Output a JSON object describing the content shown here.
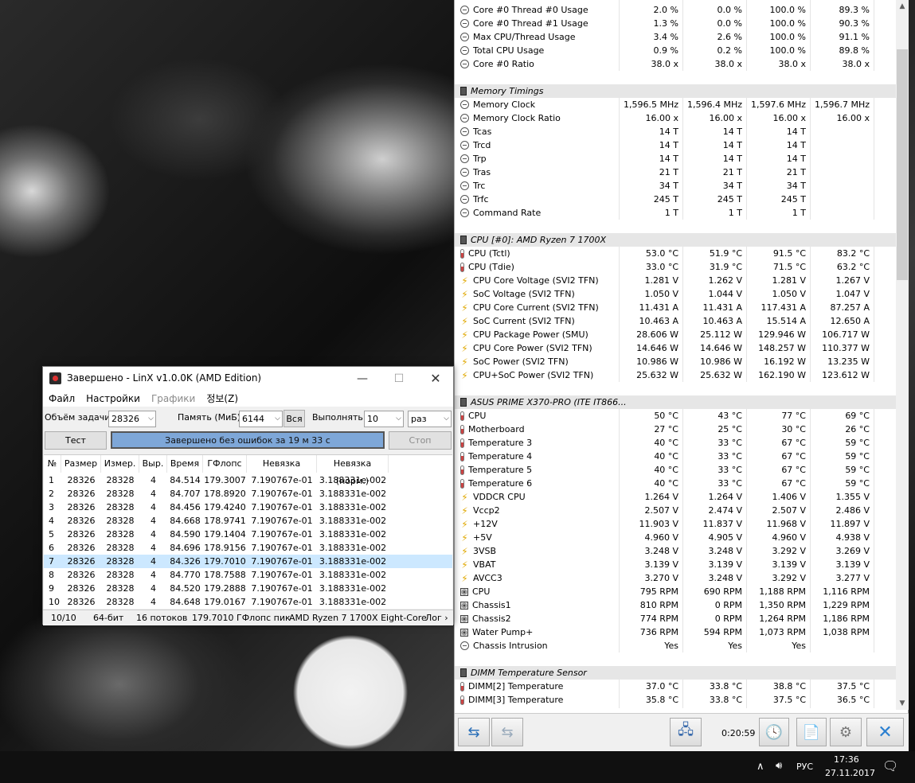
{
  "hwinfo": {
    "rows": [
      {
        "t": "r",
        "icon": "min",
        "name": "Core #0 Thread #0 Usage",
        "v": [
          "2.0 %",
          "0.0 %",
          "100.0 %",
          "89.3 %"
        ]
      },
      {
        "t": "r",
        "icon": "min",
        "name": "Core #0 Thread #1 Usage",
        "v": [
          "1.3 %",
          "0.0 %",
          "100.0 %",
          "90.3 %"
        ]
      },
      {
        "t": "r",
        "icon": "min",
        "name": "Max CPU/Thread Usage",
        "v": [
          "3.4 %",
          "2.6 %",
          "100.0 %",
          "91.1 %"
        ]
      },
      {
        "t": "r",
        "icon": "min",
        "name": "Total CPU Usage",
        "v": [
          "0.9 %",
          "0.2 %",
          "100.0 %",
          "89.8 %"
        ]
      },
      {
        "t": "r",
        "icon": "min",
        "name": "Core #0 Ratio",
        "v": [
          "38.0 x",
          "38.0 x",
          "38.0 x",
          "38.0 x"
        ]
      },
      {
        "t": "s"
      },
      {
        "t": "g",
        "name": "Memory Timings"
      },
      {
        "t": "r",
        "icon": "min",
        "name": "Memory Clock",
        "v": [
          "1,596.5 MHz",
          "1,596.4 MHz",
          "1,597.6 MHz",
          "1,596.7 MHz"
        ]
      },
      {
        "t": "r",
        "icon": "min",
        "name": "Memory Clock Ratio",
        "v": [
          "16.00 x",
          "16.00 x",
          "16.00 x",
          "16.00 x"
        ]
      },
      {
        "t": "r",
        "icon": "min",
        "name": "Tcas",
        "v": [
          "14 T",
          "14 T",
          "14 T",
          ""
        ]
      },
      {
        "t": "r",
        "icon": "min",
        "name": "Trcd",
        "v": [
          "14 T",
          "14 T",
          "14 T",
          ""
        ]
      },
      {
        "t": "r",
        "icon": "min",
        "name": "Trp",
        "v": [
          "14 T",
          "14 T",
          "14 T",
          ""
        ]
      },
      {
        "t": "r",
        "icon": "min",
        "name": "Tras",
        "v": [
          "21 T",
          "21 T",
          "21 T",
          ""
        ]
      },
      {
        "t": "r",
        "icon": "min",
        "name": "Trc",
        "v": [
          "34 T",
          "34 T",
          "34 T",
          ""
        ]
      },
      {
        "t": "r",
        "icon": "min",
        "name": "Trfc",
        "v": [
          "245 T",
          "245 T",
          "245 T",
          ""
        ]
      },
      {
        "t": "r",
        "icon": "min",
        "name": "Command Rate",
        "v": [
          "1 T",
          "1 T",
          "1 T",
          ""
        ]
      },
      {
        "t": "s"
      },
      {
        "t": "g",
        "name": "CPU [#0]: AMD Ryzen 7 1700X"
      },
      {
        "t": "r",
        "icon": "therm",
        "name": "CPU (Tctl)",
        "v": [
          "53.0 °C",
          "51.9 °C",
          "91.5 °C",
          "83.2 °C"
        ]
      },
      {
        "t": "r",
        "icon": "therm",
        "name": "CPU (Tdie)",
        "v": [
          "33.0 °C",
          "31.9 °C",
          "71.5 °C",
          "63.2 °C"
        ]
      },
      {
        "t": "r",
        "icon": "volt",
        "name": "CPU Core Voltage (SVI2 TFN)",
        "v": [
          "1.281 V",
          "1.262 V",
          "1.281 V",
          "1.267 V"
        ]
      },
      {
        "t": "r",
        "icon": "volt",
        "name": "SoC Voltage (SVI2 TFN)",
        "v": [
          "1.050 V",
          "1.044 V",
          "1.050 V",
          "1.047 V"
        ]
      },
      {
        "t": "r",
        "icon": "volt",
        "name": "CPU Core Current (SVI2 TFN)",
        "v": [
          "11.431 A",
          "11.431 A",
          "117.431 A",
          "87.257 A"
        ]
      },
      {
        "t": "r",
        "icon": "volt",
        "name": "SoC Current (SVI2 TFN)",
        "v": [
          "10.463 A",
          "10.463 A",
          "15.514 A",
          "12.650 A"
        ]
      },
      {
        "t": "r",
        "icon": "volt",
        "name": "CPU Package Power (SMU)",
        "v": [
          "28.606 W",
          "25.112 W",
          "129.946 W",
          "106.717 W"
        ]
      },
      {
        "t": "r",
        "icon": "volt",
        "name": "CPU Core Power (SVI2 TFN)",
        "v": [
          "14.646 W",
          "14.646 W",
          "148.257 W",
          "110.377 W"
        ]
      },
      {
        "t": "r",
        "icon": "volt",
        "name": "SoC Power (SVI2 TFN)",
        "v": [
          "10.986 W",
          "10.986 W",
          "16.192 W",
          "13.235 W"
        ]
      },
      {
        "t": "r",
        "icon": "volt",
        "name": "CPU+SoC Power (SVI2 TFN)",
        "v": [
          "25.632 W",
          "25.632 W",
          "162.190 W",
          "123.612 W"
        ]
      },
      {
        "t": "s"
      },
      {
        "t": "g",
        "name": "ASUS PRIME X370-PRO (ITE IT866..."
      },
      {
        "t": "r",
        "icon": "therm",
        "name": "CPU",
        "v": [
          "50 °C",
          "43 °C",
          "77 °C",
          "69 °C"
        ]
      },
      {
        "t": "r",
        "icon": "therm",
        "name": "Motherboard",
        "v": [
          "27 °C",
          "25 °C",
          "30 °C",
          "26 °C"
        ]
      },
      {
        "t": "r",
        "icon": "therm",
        "name": "Temperature 3",
        "v": [
          "40 °C",
          "33 °C",
          "67 °C",
          "59 °C"
        ]
      },
      {
        "t": "r",
        "icon": "therm",
        "name": "Temperature 4",
        "v": [
          "40 °C",
          "33 °C",
          "67 °C",
          "59 °C"
        ]
      },
      {
        "t": "r",
        "icon": "therm",
        "name": "Temperature 5",
        "v": [
          "40 °C",
          "33 °C",
          "67 °C",
          "59 °C"
        ]
      },
      {
        "t": "r",
        "icon": "therm",
        "name": "Temperature 6",
        "v": [
          "40 °C",
          "33 °C",
          "67 °C",
          "59 °C"
        ]
      },
      {
        "t": "r",
        "icon": "volt",
        "name": "VDDCR CPU",
        "v": [
          "1.264 V",
          "1.264 V",
          "1.406 V",
          "1.355 V"
        ]
      },
      {
        "t": "r",
        "icon": "volt",
        "name": "Vccp2",
        "v": [
          "2.507 V",
          "2.474 V",
          "2.507 V",
          "2.486 V"
        ]
      },
      {
        "t": "r",
        "icon": "volt",
        "name": "+12V",
        "v": [
          "11.903 V",
          "11.837 V",
          "11.968 V",
          "11.897 V"
        ]
      },
      {
        "t": "r",
        "icon": "volt",
        "name": "+5V",
        "v": [
          "4.960 V",
          "4.905 V",
          "4.960 V",
          "4.938 V"
        ]
      },
      {
        "t": "r",
        "icon": "volt",
        "name": "3VSB",
        "v": [
          "3.248 V",
          "3.248 V",
          "3.292 V",
          "3.269 V"
        ]
      },
      {
        "t": "r",
        "icon": "volt",
        "name": "VBAT",
        "v": [
          "3.139 V",
          "3.139 V",
          "3.139 V",
          "3.139 V"
        ]
      },
      {
        "t": "r",
        "icon": "volt",
        "name": "AVCC3",
        "v": [
          "3.270 V",
          "3.248 V",
          "3.292 V",
          "3.277 V"
        ]
      },
      {
        "t": "r",
        "icon": "fan",
        "name": "CPU",
        "v": [
          "795 RPM",
          "690 RPM",
          "1,188 RPM",
          "1,116 RPM"
        ]
      },
      {
        "t": "r",
        "icon": "fan",
        "name": "Chassis1",
        "v": [
          "810 RPM",
          "0 RPM",
          "1,350 RPM",
          "1,229 RPM"
        ]
      },
      {
        "t": "r",
        "icon": "fan",
        "name": "Chassis2",
        "v": [
          "774 RPM",
          "0 RPM",
          "1,264 RPM",
          "1,186 RPM"
        ]
      },
      {
        "t": "r",
        "icon": "fan",
        "name": "Water Pump+",
        "v": [
          "736 RPM",
          "594 RPM",
          "1,073 RPM",
          "1,038 RPM"
        ]
      },
      {
        "t": "r",
        "icon": "min",
        "name": "Chassis Intrusion",
        "v": [
          "Yes",
          "Yes",
          "Yes",
          ""
        ]
      },
      {
        "t": "s"
      },
      {
        "t": "g",
        "name": "DIMM Temperature Sensor"
      },
      {
        "t": "r",
        "icon": "therm",
        "name": "DIMM[2] Temperature",
        "v": [
          "37.0 °C",
          "33.8 °C",
          "38.8 °C",
          "37.5 °C"
        ]
      },
      {
        "t": "r",
        "icon": "therm",
        "name": "DIMM[3] Temperature",
        "v": [
          "35.8 °C",
          "33.8 °C",
          "37.5 °C",
          "36.5 °C"
        ]
      }
    ],
    "timer": "0:20:59"
  },
  "linx": {
    "title": "Завершено - LinX v1.0.0K (AMD Edition)",
    "menu": [
      "Файл",
      "Настройки",
      "Графики",
      "정보(Z)"
    ],
    "options": {
      "task_size_label": "Объём задачи:",
      "task_size": "28326",
      "memory_label": "Память (МиБ):",
      "memory": "6144",
      "all_button": "Вся",
      "run_label": "Выполнять:",
      "run_count": "10",
      "run_unit": "раз"
    },
    "test_button": "Тест",
    "stop_button": "Стоп",
    "progress_text": "Завершено без ошибок за 19 м 33 с",
    "progress_fraction": 1.0,
    "columns": [
      "№",
      "Размер",
      "Измер.",
      "Выр.",
      "Время",
      "ГФлопс",
      "Невязка",
      "Невязка (норм.)"
    ],
    "rows": [
      [
        "1",
        "28326",
        "28328",
        "4",
        "84.514",
        "179.3007",
        "7.190767e-01",
        "3.188331e-002"
      ],
      [
        "2",
        "28326",
        "28328",
        "4",
        "84.707",
        "178.8920",
        "7.190767e-01",
        "3.188331e-002"
      ],
      [
        "3",
        "28326",
        "28328",
        "4",
        "84.456",
        "179.4240",
        "7.190767e-01",
        "3.188331e-002"
      ],
      [
        "4",
        "28326",
        "28328",
        "4",
        "84.668",
        "178.9741",
        "7.190767e-01",
        "3.188331e-002"
      ],
      [
        "5",
        "28326",
        "28328",
        "4",
        "84.590",
        "179.1404",
        "7.190767e-01",
        "3.188331e-002"
      ],
      [
        "6",
        "28326",
        "28328",
        "4",
        "84.696",
        "178.9156",
        "7.190767e-01",
        "3.188331e-002"
      ],
      [
        "7",
        "28326",
        "28328",
        "4",
        "84.326",
        "179.7010",
        "7.190767e-01",
        "3.188331e-002"
      ],
      [
        "8",
        "28326",
        "28328",
        "4",
        "84.770",
        "178.7588",
        "7.190767e-01",
        "3.188331e-002"
      ],
      [
        "9",
        "28326",
        "28328",
        "4",
        "84.520",
        "179.2888",
        "7.190767e-01",
        "3.188331e-002"
      ],
      [
        "10",
        "28326",
        "28328",
        "4",
        "84.648",
        "179.0167",
        "7.190767e-01",
        "3.188331e-002"
      ]
    ],
    "selected_row": 7,
    "status": [
      "10/10",
      "64-бит",
      "16 потоков",
      "179.7010 ГФлопс пик",
      "AMD Ryzen 7 1700X Eight-Core",
      "Лог ›"
    ]
  },
  "taskbar": {
    "lang": "РУС",
    "time": "17:36",
    "date": "27.11.2017"
  }
}
